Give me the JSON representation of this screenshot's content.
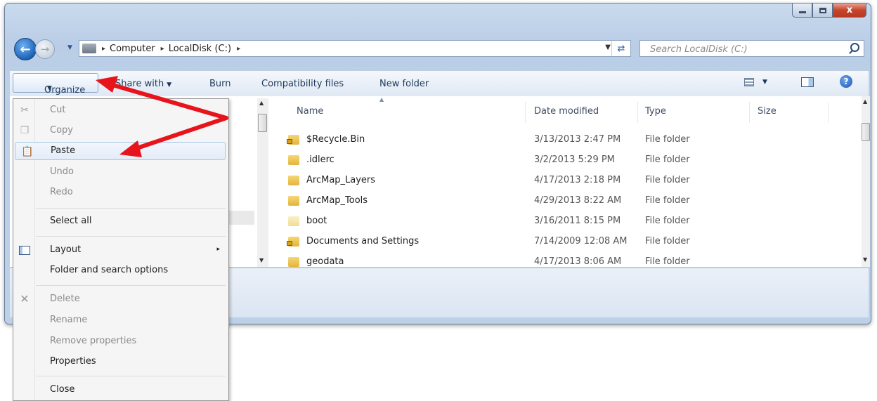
{
  "window": {
    "caption_buttons": {
      "minimize": "minimize-icon",
      "maximize": "maximize-icon",
      "close": "x"
    }
  },
  "nav": {
    "back_glyph": "←",
    "forward_glyph": "→",
    "recent_glyph": "▼"
  },
  "address": {
    "separator": "▸",
    "crumbs": [
      "Computer",
      "LocalDisk (C:)"
    ],
    "dropdown_glyph": "▼",
    "refresh_glyph": "⇄"
  },
  "search": {
    "placeholder": "Search LocalDisk (C:)"
  },
  "toolbar": {
    "organize": "Organize",
    "share_with": "Share with",
    "burn": "Burn",
    "compatibility_files": "Compatibility files",
    "new_folder": "New folder",
    "caret": "▼",
    "help": "?"
  },
  "columns": {
    "name": "Name",
    "date_modified": "Date modified",
    "type": "Type",
    "size": "Size"
  },
  "files": [
    {
      "name": "$Recycle.Bin",
      "date": "3/13/2013 2:47 PM",
      "type": "File folder"
    },
    {
      "name": ".idlerc",
      "date": "3/2/2013 5:29 PM",
      "type": "File folder"
    },
    {
      "name": "ArcMap_Layers",
      "date": "4/17/2013 2:18 PM",
      "type": "File folder"
    },
    {
      "name": "ArcMap_Tools",
      "date": "4/29/2013 8:22 AM",
      "type": "File folder"
    },
    {
      "name": "boot",
      "date": "3/16/2011 8:15 PM",
      "type": "File folder"
    },
    {
      "name": "Documents and Settings",
      "date": "7/14/2009 12:08 AM",
      "type": "File folder"
    },
    {
      "name": "geodata",
      "date": "4/17/2013 8:06 AM",
      "type": "File folder"
    }
  ],
  "menu": {
    "cut": "Cut",
    "copy": "Copy",
    "paste": "Paste",
    "undo": "Undo",
    "redo": "Redo",
    "select_all": "Select all",
    "layout": "Layout",
    "folder_options": "Folder and search options",
    "delete": "Delete",
    "rename": "Rename",
    "remove_properties": "Remove properties",
    "properties": "Properties",
    "close": "Close",
    "submenu_glyph": "▸"
  },
  "annotation": {
    "arrow_color": "#e8141b"
  }
}
